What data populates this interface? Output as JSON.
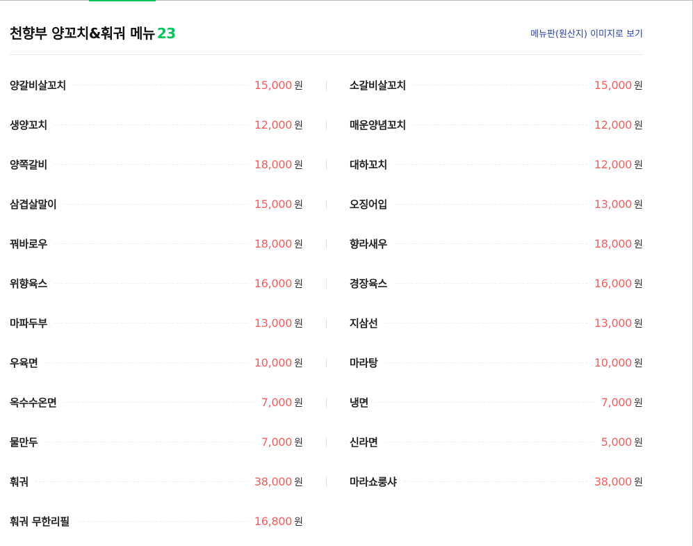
{
  "header": {
    "title": "천향부 양꼬치&훠궈 메뉴",
    "count": "23",
    "menu_image_link": "메뉴판(원산지) 이미지로 보기"
  },
  "colors": {
    "accent_green": "#03c75a",
    "price_red": "#fa5c5c",
    "link_blue": "#2b3fab"
  },
  "currency_unit": "원",
  "menu": [
    {
      "name": "양갈비살꼬치",
      "price": "15,000"
    },
    {
      "name": "소갈비살꼬치",
      "price": "15,000"
    },
    {
      "name": "생양꼬치",
      "price": "12,000"
    },
    {
      "name": "매운양념꼬치",
      "price": "12,000"
    },
    {
      "name": "양쪽갈비",
      "price": "18,000"
    },
    {
      "name": "대하꼬치",
      "price": "12,000"
    },
    {
      "name": "삼겹살말이",
      "price": "15,000"
    },
    {
      "name": "오징어입",
      "price": "13,000"
    },
    {
      "name": "꿔바로우",
      "price": "18,000"
    },
    {
      "name": "향라새우",
      "price": "18,000"
    },
    {
      "name": "위향육스",
      "price": "16,000"
    },
    {
      "name": "경장육스",
      "price": "16,000"
    },
    {
      "name": "마파두부",
      "price": "13,000"
    },
    {
      "name": "지삼선",
      "price": "13,000"
    },
    {
      "name": "우육면",
      "price": "10,000"
    },
    {
      "name": "마라탕",
      "price": "10,000"
    },
    {
      "name": "옥수수온면",
      "price": "7,000"
    },
    {
      "name": "냉면",
      "price": "7,000"
    },
    {
      "name": "물만두",
      "price": "7,000"
    },
    {
      "name": "신라면",
      "price": "5,000"
    },
    {
      "name": "훠궈",
      "price": "38,000"
    },
    {
      "name": "마라쇼룽샤",
      "price": "38,000"
    },
    {
      "name": "훠궈 무한리필",
      "price": "16,800"
    }
  ]
}
